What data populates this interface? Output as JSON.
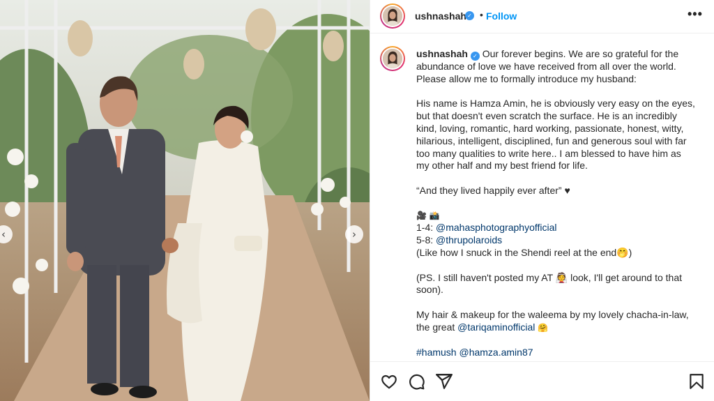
{
  "post": {
    "username": "ushnashah",
    "follow_label": "Follow",
    "separator": "•",
    "more_label": "•••",
    "verified_glyph": "✓"
  },
  "caption": {
    "username": "ushnashah",
    "p1": "Our forever begins. We are so grateful for the abundance of love we have received from all over the world. Please allow me to formally introduce my husband:",
    "p2": "His name is Hamza Amin, he is obviously very easy on the eyes, but that doesn't even scratch the surface. He is an incredibly kind, loving, romantic, hard working, passionate, honest, witty, hilarious, intelligent, disciplined, fun and generous soul with far too many qualities to write here.. I am blessed to have him as my other half and my best friend for life.",
    "p3": "“And they lived happily ever after” ♥",
    "credits_icons": "🎥 📸",
    "credit1_prefix": "1-4: ",
    "credit1_link": "@mahasphotographyofficial",
    "credit2_prefix": "5-8: ",
    "credit2_link": "@thrupolaroids",
    "credit3": "(Like how I snuck in the Shendi reel at the end🤭)",
    "ps": "(PS. I still haven't posted my AT 👰 look, I'll get around to that soon).",
    "hair_text": "My hair & makeup for the waleema by my lovely chacha-in-law, the great ",
    "hair_link": "@tariqaminofficial",
    "hair_emoji": "🤗",
    "hashtag": "#hamush",
    "mention": "@hamza.amin87"
  },
  "photo": {
    "prev_glyph": "‹",
    "next_glyph": "›"
  },
  "icons": {
    "like": "heart-icon",
    "comment": "comment-icon",
    "share": "share-icon",
    "save": "bookmark-icon"
  },
  "colors": {
    "link": "#00376b",
    "follow": "#0095f6",
    "verified": "#3897f0"
  }
}
